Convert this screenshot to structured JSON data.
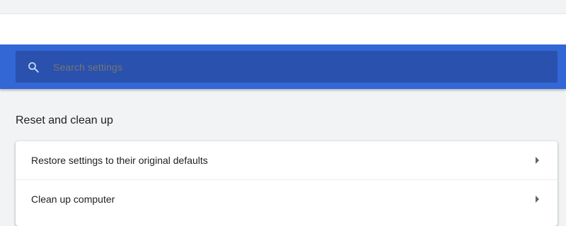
{
  "search": {
    "placeholder": "Search settings",
    "icon": "search-icon"
  },
  "section": {
    "title": "Reset and clean up",
    "items": [
      {
        "label": "Restore settings to their original defaults",
        "icon": "arrow-right-icon"
      },
      {
        "label": "Clean up computer",
        "icon": "arrow-right-icon"
      }
    ]
  },
  "colors": {
    "toolbar": "#3367d6",
    "search_box": "#2a51ad",
    "page_background": "#f1f3f4"
  }
}
